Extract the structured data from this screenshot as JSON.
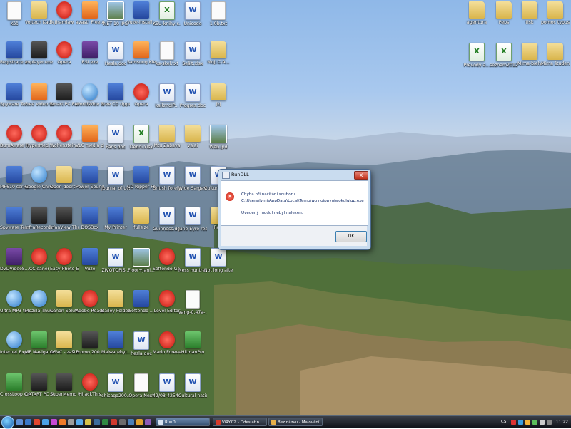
{
  "desktop": {
    "icons_left": [
      {
        "label": "Kôš",
        "type": "text"
      },
      {
        "label": "Vojtech Kaďlec",
        "type": "folder"
      },
      {
        "label": "Jiramlaw",
        "type": "red"
      },
      {
        "label": "avast! Free Antivirus",
        "type": "orange"
      },
      {
        "label": "NET 10 JPG",
        "type": "img"
      },
      {
        "label": "Vuze-install...",
        "type": "app"
      },
      {
        "label": "KSU-knihy-s...",
        "type": "excel"
      },
      {
        "label": "Unicode",
        "type": "word"
      },
      {
        "label": "1.0b.txt",
        "type": "text"
      },
      {
        "label": "Registrace a návod k ...",
        "type": "app"
      },
      {
        "label": "mplayer.exe",
        "type": "dark"
      },
      {
        "label": "Opera",
        "type": "red"
      },
      {
        "label": "RSI.exe",
        "type": "purple"
      },
      {
        "label": "Hesla.doc",
        "type": "word"
      },
      {
        "label": "Samsung Kies",
        "type": "orange"
      },
      {
        "label": "ks-skel.txt",
        "type": "text"
      },
      {
        "label": "Sešit.xlsx",
        "type": "word"
      },
      {
        "label": "Moji.C-A...",
        "type": "folder"
      },
      {
        "label": "Spyware Ter...",
        "type": "app"
      },
      {
        "label": "Free Video to Mp3 Conv...",
        "type": "orange"
      },
      {
        "label": "Smart PC Recorder",
        "type": "dark"
      },
      {
        "label": "WorldWide Telescope",
        "type": "globe"
      },
      {
        "label": "Free CD ripper",
        "type": "app"
      },
      {
        "label": "Opera",
        "type": "red"
      },
      {
        "label": "kalkmdIP...",
        "type": "word"
      },
      {
        "label": "Progres.doc",
        "type": "word"
      },
      {
        "label": "jkj",
        "type": "folder"
      },
      {
        "label": "BurnAware Free",
        "type": "red"
      },
      {
        "label": "HyperMed...",
        "type": "red"
      },
      {
        "label": "Wolfenstein...",
        "type": "red"
      },
      {
        "label": "VLC media player",
        "type": "orange"
      },
      {
        "label": "Pans.doc",
        "type": "word"
      },
      {
        "label": "Debni.xlsx",
        "type": "excel"
      },
      {
        "label": "Mtu Zábava",
        "type": "folder"
      },
      {
        "label": "vajai",
        "type": "folder"
      },
      {
        "label": "Web.jpd",
        "type": "img"
      },
      {
        "label": "MP610 series Příručka o...",
        "type": "app"
      },
      {
        "label": "Google Chrome",
        "type": "globe"
      },
      {
        "label": "Open doors - zaštupce",
        "type": "folder"
      },
      {
        "label": "Power Sound Editor Free",
        "type": "app"
      },
      {
        "label": "Journal of Urban H...",
        "type": "word"
      },
      {
        "label": "CD Ripper Freeware",
        "type": "app"
      },
      {
        "label": "British foreign ...",
        "type": "word"
      },
      {
        "label": "Wide Sargasso S...",
        "type": "word"
      },
      {
        "label": "Cultur struct...",
        "type": "word"
      },
      {
        "label": "Spyware Terminat...",
        "type": "app"
      },
      {
        "label": "InfraRecorder",
        "type": "dark"
      },
      {
        "label": "IrfanView Thumbnails",
        "type": "dark"
      },
      {
        "label": "DOSBox",
        "type": "app"
      },
      {
        "label": "My Printer",
        "type": "app"
      },
      {
        "label": "fullsize",
        "type": "folder"
      },
      {
        "label": "Guinness.doc",
        "type": "word"
      },
      {
        "label": "Jane Eyre reading ...",
        "type": "word"
      },
      {
        "label": "Relo",
        "type": "folder"
      },
      {
        "label": "DVDVideoS... Free Studio",
        "type": "purple"
      },
      {
        "label": "CCleaner",
        "type": "red"
      },
      {
        "label": "Easy-Photo-EX",
        "type": "red"
      },
      {
        "label": "Vuze",
        "type": "app"
      },
      {
        "label": "ZIVOTOPIS...",
        "type": "word"
      },
      {
        "label": "Floor+Jani...",
        "type": "img"
      },
      {
        "label": "Softendo Games World",
        "type": "red"
      },
      {
        "label": "Ness huntress.doc",
        "type": "word"
      },
      {
        "label": "Not long after this a...",
        "type": "word"
      },
      {
        "label": "Ultra MP3 to CD Burner",
        "type": "globe"
      },
      {
        "label": "Mozilla Thunderbird",
        "type": "globe"
      },
      {
        "label": "Canon Soluti...",
        "type": "folder"
      },
      {
        "label": "Adobe Reader X",
        "type": "red"
      },
      {
        "label": "Bailey Folder",
        "type": "folder"
      },
      {
        "label": "Softendo ...",
        "type": "app"
      },
      {
        "label": "Level Editor",
        "type": "red"
      },
      {
        "label": "vang-0.47a-...",
        "type": "text"
      },
      {
        "label": "Internet Explorer",
        "type": "globe"
      },
      {
        "label": "MP Navigator ...",
        "type": "green"
      },
      {
        "label": "OSVČ - zaštupce",
        "type": "folder"
      },
      {
        "label": "Promo 200...",
        "type": "dark"
      },
      {
        "label": "Malwarebyt... Anti-Malware",
        "type": "app"
      },
      {
        "label": "hesla.doc",
        "type": "word"
      },
      {
        "label": "Mario Forever",
        "type": "red"
      },
      {
        "label": "HitmanPro",
        "type": "green"
      },
      {
        "label": "CrossLoop Connect",
        "type": "green"
      },
      {
        "label": "DATART PC START BO...",
        "type": "dark"
      },
      {
        "label": "SuperMemo UX",
        "type": "dark"
      },
      {
        "label": "HijackThis",
        "type": "red"
      },
      {
        "label": "chicago200...",
        "type": "word"
      },
      {
        "label": "Opera Next",
        "type": "text"
      },
      {
        "label": "42/08-4254...",
        "type": "word"
      },
      {
        "label": "Cultural nationalism...",
        "type": "word"
      }
    ],
    "icons_right": [
      {
        "label": "agentura",
        "type": "folder"
      },
      {
        "label": "Peps",
        "type": "folder"
      },
      {
        "label": "tisk",
        "type": "folder"
      },
      {
        "label": "pomoc typuste.sp...",
        "type": "folder"
      },
      {
        "label": "Prevody-a...",
        "type": "excel"
      },
      {
        "label": "seznam2012...",
        "type": "excel"
      },
      {
        "label": "Mima-biely",
        "type": "folder"
      },
      {
        "label": "Mima študentský",
        "type": "folder"
      }
    ]
  },
  "dialog": {
    "title": "RunDLL",
    "close_glyph": "x",
    "error_icon": "error-icon",
    "line1": "Chyba při načítání souboru",
    "line2": "C:\\Users\\lymi\\AppData\\Local\\Temp\\wovjojppyniwokulqlqp.exe",
    "line3": "Uvedený modul nebyl nalezen.",
    "ok_label": "OK"
  },
  "taskbar": {
    "tasks": [
      {
        "label": "RunDLL",
        "active": true,
        "color": "#d8e4f2"
      },
      {
        "label": "ViRY.CZ - Odeslat n...",
        "active": false,
        "color": "#d83b2a"
      },
      {
        "label": "Bez názvu - Malování",
        "active": false,
        "color": "#e7b04a"
      }
    ],
    "language": "CS",
    "clock": "11:22"
  }
}
